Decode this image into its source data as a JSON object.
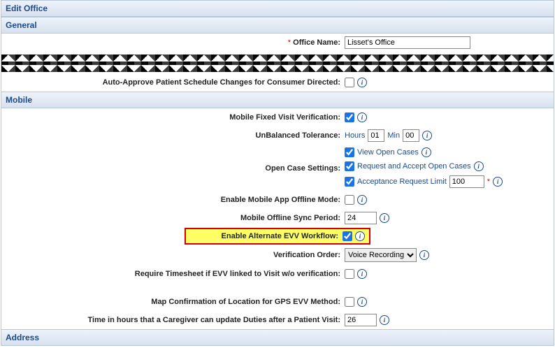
{
  "headers": {
    "edit_office": "Edit Office",
    "general": "General",
    "mobile": "Mobile",
    "address": "Address"
  },
  "general": {
    "office_name_label": "Office Name:",
    "office_name_value": "Lisset's Office",
    "auto_approve_label": "Auto-Approve Patient Schedule Changes for Consumer Directed:"
  },
  "mobile": {
    "fixed_visit_label": "Mobile Fixed Visit Verification:",
    "fixed_visit_checked": true,
    "unbalanced_label": "UnBalanced Tolerance:",
    "hours_label": "Hours",
    "min_label": "Min",
    "hours_value": "01",
    "min_value": "00",
    "open_case_label": "Open Case Settings:",
    "view_open_cases": "View Open Cases",
    "request_accept": "Request and Accept Open Cases",
    "acceptance_limit_label": "Acceptance Request Limit",
    "acceptance_limit_value": "100",
    "offline_mode_label": "Enable Mobile App Offline Mode:",
    "offline_sync_label": "Mobile Offline Sync Period:",
    "offline_sync_value": "24",
    "alt_evv_label": "Enable Alternate EVV Workflow:",
    "alt_evv_checked": true,
    "verification_order_label": "Verification Order:",
    "verification_order_value": "Voice Recording",
    "require_timesheet_label": "Require Timesheet if EVV linked to Visit w/o verification:",
    "map_confirm_label": "Map Confirmation of Location for GPS EVV Method:",
    "caregiver_update_label": "Time in hours that a Caregiver can update Duties after a Patient Visit:",
    "caregiver_update_value": "26"
  }
}
